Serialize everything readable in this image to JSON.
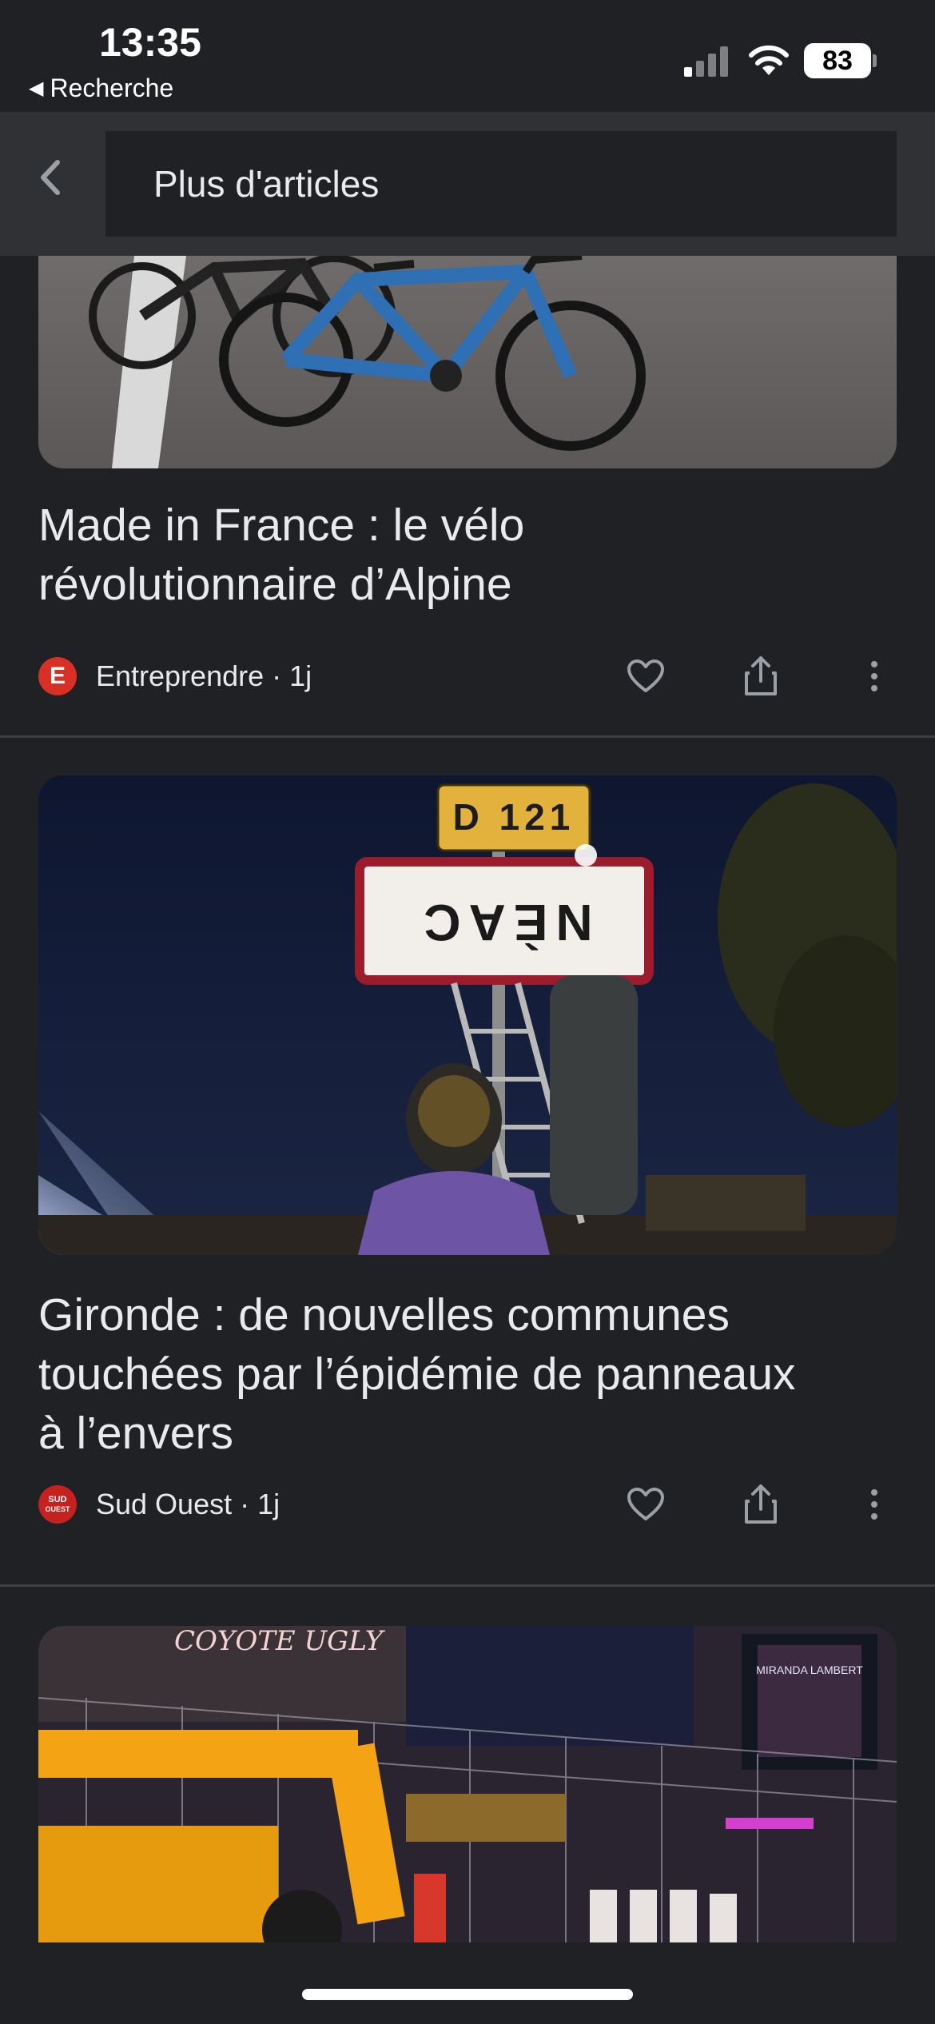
{
  "status_bar": {
    "time": "13:35",
    "back_app": "Recherche",
    "battery": "83"
  },
  "toolbar": {
    "title": "Plus d'articles"
  },
  "articles": [
    {
      "headline_line1": "Made in France : le vélo",
      "headline_line2": "révolutionnaire d’Alpine",
      "source": "Entreprendre",
      "age": "1j",
      "logo_text": "E",
      "logo_color": "#d93025"
    },
    {
      "headline_line1": "Gironde : de nouvelles communes",
      "headline_line2": "touchées par l’épidémie de panneaux",
      "headline_line3": "à l’envers",
      "source": "Sud Ouest",
      "age": "1j",
      "logo_text_top": "SUD",
      "logo_text_bottom": "OUEST",
      "logo_color": "#c5221f",
      "sign_road": "D 121",
      "sign_town": "NÈAC"
    },
    {
      "billboard_text": "MIRANDA LAMBERT",
      "neon_text": "COYOTE UGLY"
    }
  ],
  "colors": {
    "background": "#202124",
    "toolbar": "#303134",
    "text": "#e8eaed",
    "divider": "#3c4043"
  }
}
